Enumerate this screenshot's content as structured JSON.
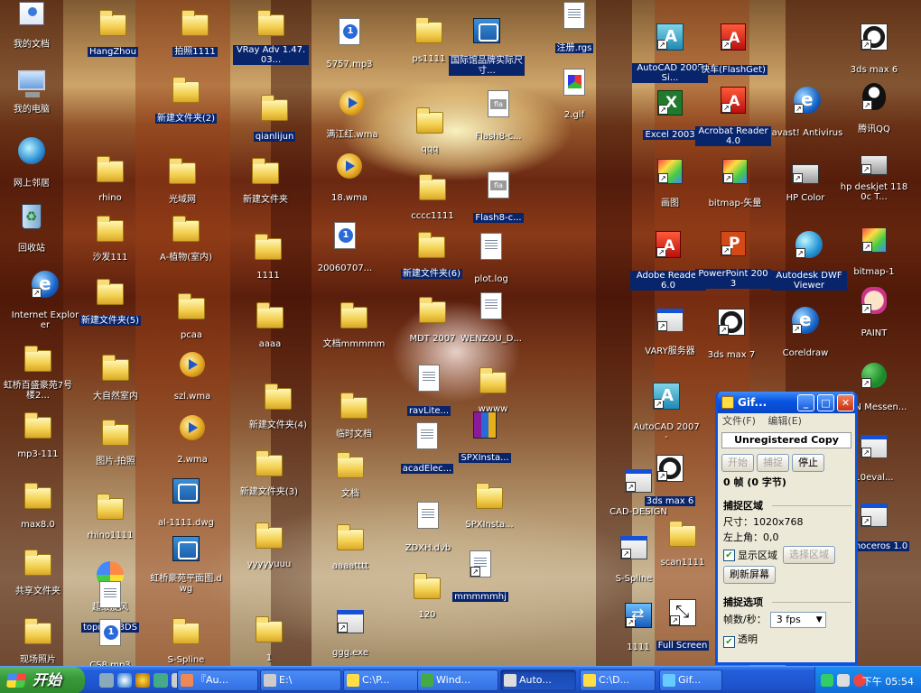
{
  "desktop": {
    "icons": [
      {
        "label": "我的文档",
        "icon": "my-documents"
      },
      {
        "label": "HangZhou",
        "icon": "folder"
      },
      {
        "label": "拍照1111",
        "icon": "folder"
      },
      {
        "label": "VRay Adv 1.47.03...",
        "icon": "folder"
      },
      {
        "label": "5757.mp3",
        "icon": "mp3"
      },
      {
        "label": "ps1111",
        "icon": "folder"
      },
      {
        "label": "国际馆品牌实际尺寸...",
        "icon": "dwg"
      },
      {
        "label": "注册.rgs",
        "icon": "document"
      },
      {
        "label": "AutoCAD 2005 Si...",
        "icon": "autocad"
      },
      {
        "label": "快车(FlashGet)",
        "icon": "flashget"
      },
      {
        "label": "3ds max 6",
        "icon": "3dsmax"
      },
      {
        "label": "我的电脑",
        "icon": "my-computer"
      },
      {
        "label": "新建文件夹(2)",
        "icon": "folder"
      },
      {
        "label": "qianlijun",
        "icon": "folder"
      },
      {
        "label": "满江红.wma",
        "icon": "audio"
      },
      {
        "label": "qqq",
        "icon": "folder"
      },
      {
        "label": "Flash8-c...",
        "icon": "flash"
      },
      {
        "label": "2.gif",
        "icon": "gif"
      },
      {
        "label": "Excel 2003",
        "icon": "excel"
      },
      {
        "label": "Acrobat Reader 4.0",
        "icon": "acrobat"
      },
      {
        "label": "avast! Antivirus",
        "icon": "avast"
      },
      {
        "label": "腾讯QQ",
        "icon": "qq"
      },
      {
        "label": "网上邻居",
        "icon": "network"
      },
      {
        "label": "rhino",
        "icon": "folder"
      },
      {
        "label": "光域网",
        "icon": "folder"
      },
      {
        "label": "新建文件夹",
        "icon": "folder"
      },
      {
        "label": "18.wma",
        "icon": "audio"
      },
      {
        "label": "cccc1111",
        "icon": "folder"
      },
      {
        "label": "Flash8-c...",
        "icon": "flash"
      },
      {
        "label": "画图",
        "icon": "paint-brush"
      },
      {
        "label": "bitmap-矢量",
        "icon": "bitmap"
      },
      {
        "label": "HP Color",
        "icon": "printer"
      },
      {
        "label": "hp deskjet 1180c T...",
        "icon": "printer"
      },
      {
        "label": "回收站",
        "icon": "recycle-bin"
      },
      {
        "label": "沙发111",
        "icon": "folder"
      },
      {
        "label": "A-植物(室内)",
        "icon": "folder"
      },
      {
        "label": "1111",
        "icon": "folder"
      },
      {
        "label": "20060707...",
        "icon": "mp3"
      },
      {
        "label": "新建文件夹(6)",
        "icon": "folder"
      },
      {
        "label": "plot.log",
        "icon": "document"
      },
      {
        "label": "Adobe Reader 6.0",
        "icon": "acrobat"
      },
      {
        "label": "PowerPoint 2003",
        "icon": "powerpoint"
      },
      {
        "label": "Autodesk DWF Viewer",
        "icon": "globe"
      },
      {
        "label": "bitmap-1",
        "icon": "bitmap"
      },
      {
        "label": "Internet Explorer",
        "icon": "internet-explorer"
      },
      {
        "label": "新建文件夹(5)",
        "icon": "folder"
      },
      {
        "label": "pcaa",
        "icon": "folder"
      },
      {
        "label": "aaaa",
        "icon": "folder"
      },
      {
        "label": "文档mmmmm",
        "icon": "folder"
      },
      {
        "label": "MDT 2007",
        "icon": "folder"
      },
      {
        "label": "WENZOU_D...",
        "icon": "document"
      },
      {
        "label": "VARY服务器",
        "icon": "application"
      },
      {
        "label": "3ds max 7",
        "icon": "3dsmax"
      },
      {
        "label": "Coreldraw",
        "icon": "corel"
      },
      {
        "label": "PAINT",
        "icon": "hand"
      },
      {
        "label": "虹桥百盛豪苑7号楼2...",
        "icon": "folder"
      },
      {
        "label": "大自然室内",
        "icon": "folder"
      },
      {
        "label": "szl.wma",
        "icon": "audio"
      },
      {
        "label": "ravLite...",
        "icon": "document"
      },
      {
        "label": "wwww",
        "icon": "folder"
      },
      {
        "label": "MSN Messen...",
        "icon": "msn"
      },
      {
        "label": "mp3-111",
        "icon": "folder"
      },
      {
        "label": "图片-拍照",
        "icon": "folder"
      },
      {
        "label": "2.wma",
        "icon": "audio"
      },
      {
        "label": "新建文件夹(4)",
        "icon": "folder"
      },
      {
        "label": "临时文档",
        "icon": "folder"
      },
      {
        "label": "SPXInsta...",
        "icon": "winrar"
      },
      {
        "label": "acadElec...",
        "icon": "document"
      },
      {
        "label": "AutoCAD 2007 -",
        "icon": "autocad"
      },
      {
        "label": "10eval...",
        "icon": "application"
      },
      {
        "label": "max8.0",
        "icon": "folder"
      },
      {
        "label": "rhino1111",
        "icon": "folder"
      },
      {
        "label": "al-1111.dwg",
        "icon": "dwg"
      },
      {
        "label": "新建文件夹(3)",
        "icon": "folder"
      },
      {
        "label": "文档",
        "icon": "folder"
      },
      {
        "label": "SPXInsta...",
        "icon": "folder"
      },
      {
        "label": "CAD-DESIGN",
        "icon": "application"
      },
      {
        "label": "3ds max 6",
        "icon": "3dsmax"
      },
      {
        "label": "Rhinoceros 1.0",
        "icon": "application"
      },
      {
        "label": "共享文件夹",
        "icon": "folder"
      },
      {
        "label": "超级旋风",
        "icon": "superfan"
      },
      {
        "label": "虹桥豪苑平面图.dwg",
        "icon": "dwg"
      },
      {
        "label": "yyyyyuuu",
        "icon": "folder"
      },
      {
        "label": "aaaatttt",
        "icon": "folder"
      },
      {
        "label": "ZDXH.dvb",
        "icon": "document"
      },
      {
        "label": "mmmmmhj",
        "icon": "chart"
      },
      {
        "label": "S-Spline",
        "icon": "spline"
      },
      {
        "label": "scan1111",
        "icon": "folder"
      },
      {
        "label": "topro模.3DS",
        "icon": "document"
      },
      {
        "label": "120",
        "icon": "folder"
      },
      {
        "label": "现场照片",
        "icon": "folder"
      },
      {
        "label": "CS8.mp3",
        "icon": "mp3"
      },
      {
        "label": "S-Spline",
        "icon": "folder"
      },
      {
        "label": "1",
        "icon": "folder"
      },
      {
        "label": "ggg.exe",
        "icon": "ggg"
      },
      {
        "label": "1111",
        "icon": "arrow"
      },
      {
        "label": "Full Screen",
        "icon": "resize"
      }
    ]
  },
  "gif_window": {
    "title": "Gif...",
    "menu": [
      "文件(F)",
      "编辑(E)"
    ],
    "unregistered": "Unregistered Copy",
    "buttons": {
      "start": "开始",
      "capture": "捕捉",
      "stop": "停止"
    },
    "frames": "0 帧 (0 字节)",
    "capture_area_heading": "捕捉区域",
    "size_label": "尺寸：",
    "size_value": "1020x768",
    "topleft_label": "左上角：",
    "topleft_value": "0,0",
    "show_area_label": "显示区域",
    "select_area_button": "选择区域",
    "refresh_button": "刷新屏幕",
    "options_heading": "捕捉选项",
    "fps_label": "帧数/秒：",
    "fps_value": "3 fps",
    "transparent_label": "透明"
  },
  "taskbar": {
    "start_label": "开始",
    "tasks": [
      {
        "label": "『Au...",
        "color": "#e85"
      },
      {
        "label": "E:\\",
        "color": "#ccc"
      },
      {
        "label": "C:\\P...",
        "color": "#fd4"
      },
      {
        "label": "Wind...",
        "color": "#4a4"
      },
      {
        "label": "Auto...",
        "color": "#ddd",
        "active": true
      },
      {
        "label": "C:\\D...",
        "color": "#fd4"
      },
      {
        "label": "Gif...",
        "color": "#6cf"
      }
    ],
    "clock": "下午 05:54"
  },
  "colors": {
    "selection": "#08246b",
    "titlebar": "#0a54e0",
    "taskbar": "#245edb",
    "start": "#3a9a3a"
  }
}
